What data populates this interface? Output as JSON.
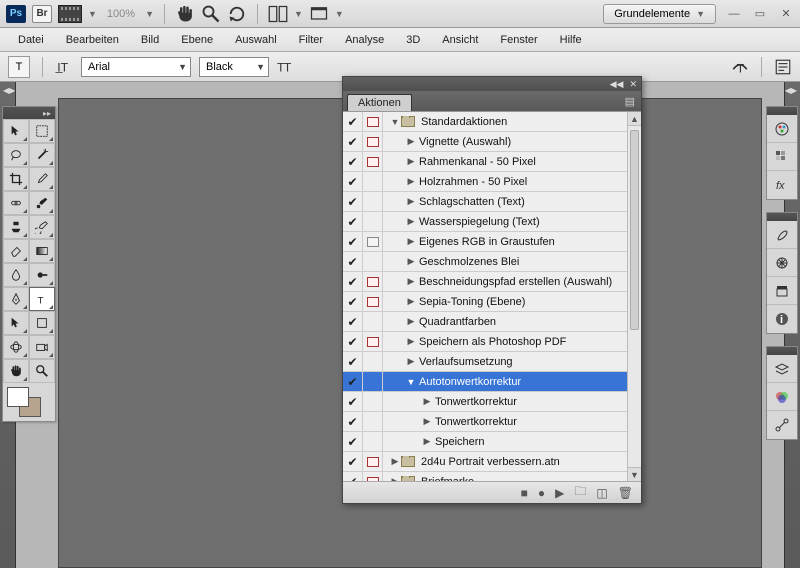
{
  "appbar": {
    "zoom": "100%",
    "workspace_label": "Grundelemente"
  },
  "menu": {
    "items": [
      "Datei",
      "Bearbeiten",
      "Bild",
      "Ebene",
      "Auswahl",
      "Filter",
      "Analyse",
      "3D",
      "Ansicht",
      "Fenster",
      "Hilfe"
    ]
  },
  "options": {
    "tool_glyph": "T",
    "font_family": "Arial",
    "font_style": "Black"
  },
  "actions_panel": {
    "tab": "Aktionen",
    "rows": [
      {
        "check": true,
        "dialog": "red",
        "indent": 0,
        "disclosure": "down",
        "folder": true,
        "label": "Standardaktionen",
        "selected": false,
        "cursor": true
      },
      {
        "check": true,
        "dialog": "red",
        "indent": 1,
        "disclosure": "right",
        "folder": false,
        "label": "Vignette (Auswahl)"
      },
      {
        "check": true,
        "dialog": "red",
        "indent": 1,
        "disclosure": "right",
        "folder": false,
        "label": "Rahmenkanal - 50 Pixel"
      },
      {
        "check": true,
        "dialog": "none",
        "indent": 1,
        "disclosure": "right",
        "folder": false,
        "label": "Holzrahmen - 50 Pixel"
      },
      {
        "check": true,
        "dialog": "none",
        "indent": 1,
        "disclosure": "right",
        "folder": false,
        "label": "Schlagschatten (Text)"
      },
      {
        "check": true,
        "dialog": "none",
        "indent": 1,
        "disclosure": "right",
        "folder": false,
        "label": "Wasserspiegelung (Text)"
      },
      {
        "check": true,
        "dialog": "gray",
        "indent": 1,
        "disclosure": "right",
        "folder": false,
        "label": "Eigenes RGB in Graustufen"
      },
      {
        "check": true,
        "dialog": "none",
        "indent": 1,
        "disclosure": "right",
        "folder": false,
        "label": "Geschmolzenes Blei"
      },
      {
        "check": true,
        "dialog": "red",
        "indent": 1,
        "disclosure": "right",
        "folder": false,
        "label": "Beschneidungspfad erstellen (Auswahl)"
      },
      {
        "check": true,
        "dialog": "red",
        "indent": 1,
        "disclosure": "right",
        "folder": false,
        "label": "Sepia-Toning (Ebene)"
      },
      {
        "check": true,
        "dialog": "none",
        "indent": 1,
        "disclosure": "right",
        "folder": false,
        "label": "Quadrantfarben"
      },
      {
        "check": true,
        "dialog": "red",
        "indent": 1,
        "disclosure": "right",
        "folder": false,
        "label": "Speichern als Photoshop PDF"
      },
      {
        "check": true,
        "dialog": "none",
        "indent": 1,
        "disclosure": "right",
        "folder": false,
        "label": "Verlaufsumsetzung"
      },
      {
        "check": true,
        "dialog": "none",
        "indent": 1,
        "disclosure": "down",
        "folder": false,
        "label": "Autotonwertkorrektur",
        "selected": true
      },
      {
        "check": true,
        "dialog": "none",
        "indent": 2,
        "disclosure": "right",
        "folder": false,
        "label": "Tonwertkorrektur"
      },
      {
        "check": true,
        "dialog": "none",
        "indent": 2,
        "disclosure": "right",
        "folder": false,
        "label": "Tonwertkorrektur"
      },
      {
        "check": true,
        "dialog": "none",
        "indent": 2,
        "disclosure": "right",
        "folder": false,
        "label": "Speichern"
      },
      {
        "check": true,
        "dialog": "red",
        "indent": 0,
        "disclosure": "right",
        "folder": true,
        "label": "2d4u Portrait verbessern.atn"
      },
      {
        "check": true,
        "dialog": "red",
        "indent": 0,
        "disclosure": "right",
        "folder": true,
        "label": "Briefmarke"
      }
    ]
  }
}
